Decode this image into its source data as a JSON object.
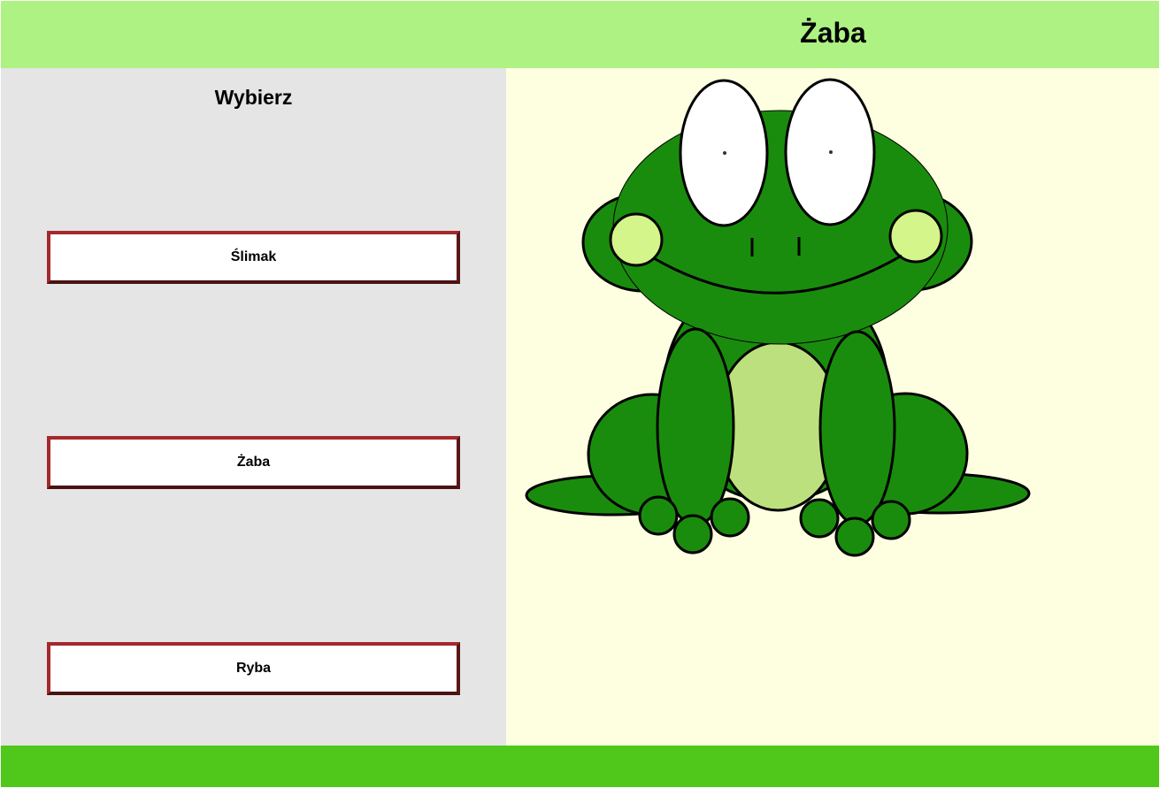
{
  "header": {
    "title": "Żaba"
  },
  "sidebar": {
    "title": "Wybierz",
    "options": [
      {
        "label": "Ślimak"
      },
      {
        "label": "Żaba"
      },
      {
        "label": "Ryba"
      }
    ]
  },
  "illustration": {
    "subject": "frog-illustration"
  },
  "colors": {
    "header_bg": "#adf283",
    "sidebar_bg": "#e5e5e5",
    "canvas_bg": "#fefee0",
    "footer_bg": "#50c71b",
    "button_border": "#a5282c",
    "frog_green": "#1a8c0d",
    "frog_belly": "#bde07e",
    "frog_cheek": "#d4f58a"
  }
}
